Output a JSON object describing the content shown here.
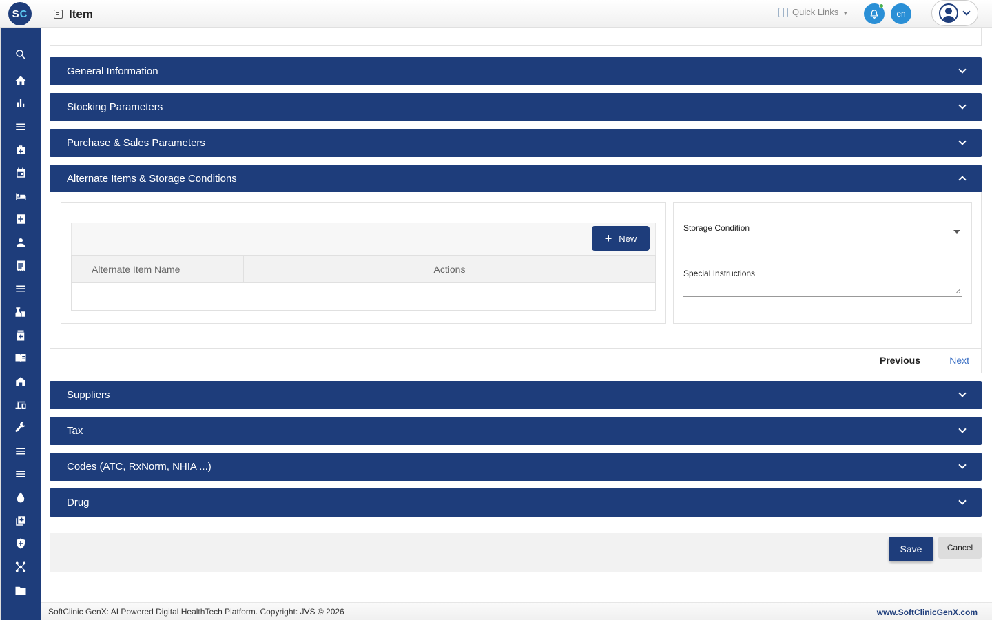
{
  "header": {
    "logo_text": "SC",
    "title": "Item",
    "quick_links": "Quick Links",
    "lang": "en"
  },
  "sidebar": {
    "icons": [
      "search-icon",
      "home-icon",
      "bar-chart-icon",
      "menu-icon",
      "briefcase-medical-icon",
      "calendar-icon",
      "bed-icon",
      "medical-cross-icon",
      "user-icon",
      "receipt-icon",
      "list-icon",
      "vials-icon",
      "medicine-bottle-icon",
      "book-icon",
      "store-icon",
      "devices-icon",
      "wrench-icon",
      "list-alt-icon",
      "list-alt2-icon",
      "blood-drop-icon",
      "add-box-icon",
      "shield-icon",
      "network-icon",
      "folder-icon"
    ]
  },
  "sections": {
    "general": "General Information",
    "stocking": "Stocking Parameters",
    "purchase": "Purchase & Sales Parameters",
    "alternate": "Alternate Items & Storage Conditions",
    "suppliers": "Suppliers",
    "tax": "Tax",
    "codes": "Codes (ATC, RxNorm, NHIA ...)",
    "drug": "Drug"
  },
  "alternate_panel": {
    "new_button": "New",
    "col_name": "Alternate Item Name",
    "col_actions": "Actions",
    "storage_label": "Storage Condition",
    "instructions_label": "Special Instructions",
    "previous": "Previous",
    "next": "Next"
  },
  "actions": {
    "save": "Save",
    "cancel": "Cancel"
  },
  "footer": {
    "copyright": "SoftClinic GenX: AI Powered Digital HealthTech Platform. Copyright: JVS © 2026",
    "website": "www.SoftClinicGenX.com"
  },
  "colors": {
    "primary": "#1e3d7b",
    "accent": "#2a8fd6",
    "link": "#3a6fc4"
  }
}
